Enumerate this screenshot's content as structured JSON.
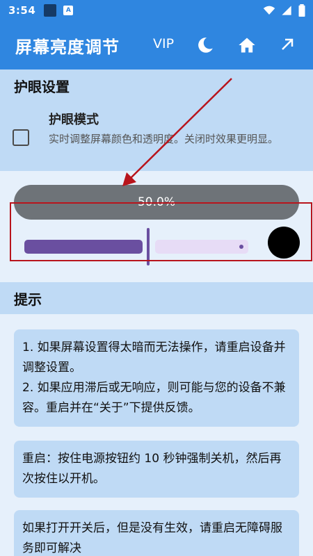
{
  "status_bar": {
    "time": "3:54",
    "notification_icon_label": "A",
    "icons": [
      "wifi-icon",
      "signal-icon",
      "battery-icon"
    ]
  },
  "app_bar": {
    "title": "屏幕亮度调节",
    "vip_label": "VIP",
    "actions": [
      "moon-icon",
      "home-icon",
      "share-arrow-icon"
    ]
  },
  "eye_care": {
    "section_title": "护眼设置",
    "mode_title": "护眼模式",
    "mode_description": "实时调整屏幕颜色和透明度。关闭时效果更明显。",
    "checked": false
  },
  "brightness": {
    "percent_label": "50.0%",
    "slider_value_fraction": 0.5,
    "preview_color": "#000000"
  },
  "tips": {
    "section_title": "提示",
    "cards": [
      {
        "lines": [
          "1. 如果屏幕设置得太暗而无法操作，请重启设备并调整设置。",
          "2. 如果应用滞后或无响应，则可能与您的设备不兼容。重启并在“关于”下提供反馈。"
        ]
      },
      {
        "lines": [
          "重启：按住电源按钮约 10 秒钟强制关机，然后再次按住以开机。"
        ]
      },
      {
        "lines": [
          "如果打开开关后，但是没有生效，请重启无障碍服务即可解决"
        ]
      }
    ]
  },
  "colors": {
    "primary": "#2f86e0",
    "header_bg": "#bfdaf5",
    "slider_accent": "#6a4fa0",
    "annotation": "#b8141c"
  }
}
